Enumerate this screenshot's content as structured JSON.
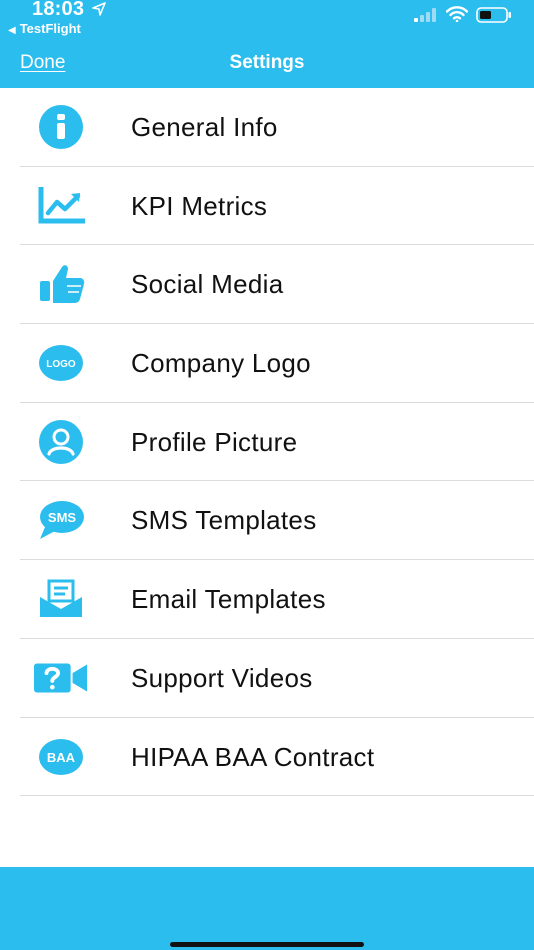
{
  "status_bar": {
    "time": "18:03",
    "back_app": "TestFlight"
  },
  "nav": {
    "done_label": "Done",
    "title": "Settings"
  },
  "colors": {
    "accent": "#2bbdee",
    "icon": "#2bbdee",
    "text": "#111111",
    "divider": "#dcdcdc"
  },
  "items": [
    {
      "label": "General Info",
      "icon": "info-icon"
    },
    {
      "label": "KPI Metrics",
      "icon": "chart-icon"
    },
    {
      "label": "Social Media",
      "icon": "thumbs-up-icon"
    },
    {
      "label": "Company Logo",
      "icon": "logo-badge-icon",
      "icon_text": "LOGO"
    },
    {
      "label": "Profile Picture",
      "icon": "user-avatar-icon"
    },
    {
      "label": "SMS Templates",
      "icon": "sms-bubble-icon",
      "icon_text": "SMS"
    },
    {
      "label": "Email Templates",
      "icon": "email-icon"
    },
    {
      "label": "Support Videos",
      "icon": "video-question-icon"
    },
    {
      "label": "HIPAA BAA Contract",
      "icon": "baa-badge-icon",
      "icon_text": "BAA"
    }
  ]
}
